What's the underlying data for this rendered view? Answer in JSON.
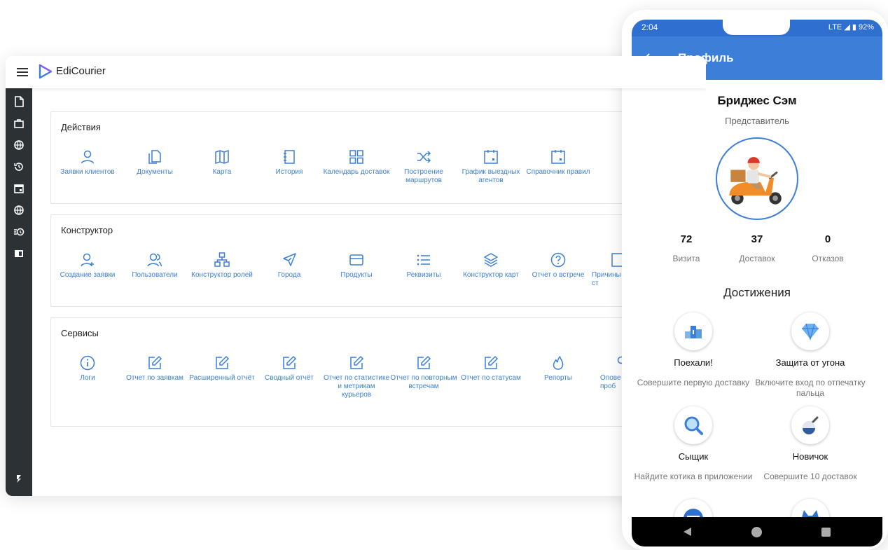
{
  "app": {
    "name": "EdiCourier"
  },
  "sections": {
    "actions": {
      "title": "Действия",
      "items": [
        "Заявки клиентов",
        "Документы",
        "Карта",
        "История",
        "Календарь доставок",
        "Построение маршрутов",
        "График выездных агентов",
        "Справочник правил"
      ]
    },
    "constructor": {
      "title": "Конструктор",
      "items": [
        "Создание заявки",
        "Пользователи",
        "Конструктор ролей",
        "Города",
        "Продукты",
        "Реквизиты",
        "Конструктор карт",
        "Отчет о встрече",
        "Причины в ст"
      ]
    },
    "services": {
      "title": "Сервисы",
      "items": [
        "Логи",
        "Отчет по заявкам",
        "Расширенный отчёт",
        "Сводный отчёт",
        "Отчет по статистике и метрикам курьеров",
        "Отчет по повторным встречам",
        "Отчет по статусам",
        "Репорты",
        "Опове проб"
      ]
    }
  },
  "phone": {
    "status": {
      "time": "2:04",
      "network": "LTE",
      "battery": "92%"
    },
    "title": "Профиль",
    "name": "Бриджес Сэм",
    "role": "Представитель",
    "stats": [
      {
        "value": "72",
        "label": "Визита"
      },
      {
        "value": "37",
        "label": "Доставок"
      },
      {
        "value": "0",
        "label": "Отказов"
      }
    ],
    "achievements_title": "Достижения",
    "achievements": [
      {
        "name": "Поехали!",
        "desc": "Совершите первую доставку",
        "icon": "podium-icon"
      },
      {
        "name": "Защита от угона",
        "desc": "Включите вход по отпечатку пальца",
        "icon": "diamond-icon"
      },
      {
        "name": "Сыщик",
        "desc": "Найдите котика в приложении",
        "icon": "magnifier-icon"
      },
      {
        "name": "Новичок",
        "desc": "Совершите 10 доставок",
        "icon": "flask-icon"
      }
    ]
  },
  "colors": {
    "accent": "#3c7fd8",
    "tile_text": "#3b7fd4",
    "sidebar": "#2c3136"
  }
}
